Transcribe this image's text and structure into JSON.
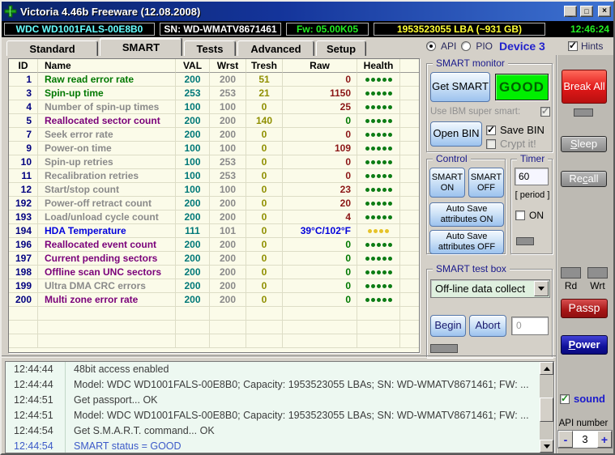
{
  "window": {
    "title": "Victoria 4.46b Freeware (12.08.2008)",
    "controls": {
      "minimize": "_",
      "maximize": "□",
      "close": "×"
    }
  },
  "infobar": {
    "model": "WDC WD1001FALS-00E8B0",
    "serial": "SN: WD-WMATV8671461",
    "firmware": "Fw: 05.00K05",
    "capacity": "1953523055 LBA (~931 GB)",
    "clock": "12:46:24"
  },
  "tabs": {
    "standard": "Standard",
    "smart": "SMART",
    "tests": "Tests",
    "advanced": "Advanced",
    "setup": "Setup"
  },
  "mode": {
    "api": "API",
    "pio": "PIO",
    "device": "Device 3",
    "hints": "Hints"
  },
  "smart_table": {
    "headers": {
      "id": "ID",
      "name": "Name",
      "val": "VAL",
      "wrst": "Wrst",
      "tresh": "Tresh",
      "raw": "Raw",
      "health": "Health"
    },
    "rows": [
      {
        "id": "1",
        "name": "Raw read error rate",
        "name_color": "green",
        "val": "200",
        "wrst": "200",
        "tresh": "51",
        "raw": "0",
        "raw_color": "red",
        "health_dots": 5,
        "health_color": "health_green"
      },
      {
        "id": "3",
        "name": "Spin-up time",
        "name_color": "green",
        "val": "253",
        "wrst": "253",
        "tresh": "21",
        "raw": "1150",
        "raw_color": "red",
        "health_dots": 5,
        "health_color": "health_green"
      },
      {
        "id": "4",
        "name": "Number of spin-up times",
        "name_color": "gray",
        "val": "100",
        "wrst": "100",
        "tresh": "0",
        "raw": "25",
        "raw_color": "red",
        "health_dots": 5,
        "health_color": "health_green"
      },
      {
        "id": "5",
        "name": "Reallocated sector count",
        "name_color": "purple",
        "val": "200",
        "wrst": "200",
        "tresh": "140",
        "raw": "0",
        "raw_color": "green",
        "health_dots": 5,
        "health_color": "health_green"
      },
      {
        "id": "7",
        "name": "Seek error rate",
        "name_color": "gray",
        "val": "200",
        "wrst": "200",
        "tresh": "0",
        "raw": "0",
        "raw_color": "red",
        "health_dots": 5,
        "health_color": "health_green"
      },
      {
        "id": "9",
        "name": "Power-on time",
        "name_color": "gray",
        "val": "100",
        "wrst": "100",
        "tresh": "0",
        "raw": "109",
        "raw_color": "red",
        "health_dots": 5,
        "health_color": "health_green"
      },
      {
        "id": "10",
        "name": "Spin-up retries",
        "name_color": "gray",
        "val": "100",
        "wrst": "253",
        "tresh": "0",
        "raw": "0",
        "raw_color": "red",
        "health_dots": 5,
        "health_color": "health_green"
      },
      {
        "id": "11",
        "name": "Recalibration retries",
        "name_color": "gray",
        "val": "100",
        "wrst": "253",
        "tresh": "0",
        "raw": "0",
        "raw_color": "red",
        "health_dots": 5,
        "health_color": "health_green"
      },
      {
        "id": "12",
        "name": "Start/stop count",
        "name_color": "gray",
        "val": "100",
        "wrst": "100",
        "tresh": "0",
        "raw": "23",
        "raw_color": "red",
        "health_dots": 5,
        "health_color": "health_green"
      },
      {
        "id": "192",
        "name": "Power-off retract count",
        "name_color": "gray",
        "val": "200",
        "wrst": "200",
        "tresh": "0",
        "raw": "20",
        "raw_color": "red",
        "health_dots": 5,
        "health_color": "health_green"
      },
      {
        "id": "193",
        "name": "Load/unload cycle count",
        "name_color": "gray",
        "val": "200",
        "wrst": "200",
        "tresh": "0",
        "raw": "4",
        "raw_color": "red",
        "health_dots": 5,
        "health_color": "health_green"
      },
      {
        "id": "194",
        "name": "HDA Temperature",
        "name_color": "blue",
        "val": "111",
        "wrst": "101",
        "tresh": "0",
        "raw": "39°C/102°F",
        "raw_color": "blue",
        "health_dots": 4,
        "health_color": "health_yellow"
      },
      {
        "id": "196",
        "name": "Reallocated event count",
        "name_color": "purple",
        "val": "200",
        "wrst": "200",
        "tresh": "0",
        "raw": "0",
        "raw_color": "green",
        "health_dots": 5,
        "health_color": "health_green"
      },
      {
        "id": "197",
        "name": "Current pending sectors",
        "name_color": "purple",
        "val": "200",
        "wrst": "200",
        "tresh": "0",
        "raw": "0",
        "raw_color": "green",
        "health_dots": 5,
        "health_color": "health_green"
      },
      {
        "id": "198",
        "name": "Offline scan UNC sectors",
        "name_color": "purple",
        "val": "200",
        "wrst": "200",
        "tresh": "0",
        "raw": "0",
        "raw_color": "green",
        "health_dots": 5,
        "health_color": "health_green"
      },
      {
        "id": "199",
        "name": "Ultra DMA CRC errors",
        "name_color": "gray",
        "val": "200",
        "wrst": "200",
        "tresh": "0",
        "raw": "0",
        "raw_color": "green",
        "health_dots": 5,
        "health_color": "health_green"
      },
      {
        "id": "200",
        "name": "Multi zone error rate",
        "name_color": "purple",
        "val": "200",
        "wrst": "200",
        "tresh": "0",
        "raw": "0",
        "raw_color": "green",
        "health_dots": 5,
        "health_color": "health_green"
      }
    ],
    "empty_rows": 3
  },
  "smart_monitor": {
    "title": "SMART monitor",
    "get_smart": "Get SMART",
    "status": "GOOD",
    "ibm_label": "Use IBM super smart:",
    "open_bin": "Open BIN",
    "save_bin": "Save BIN",
    "crypt_it": "Crypt it!"
  },
  "control": {
    "title": "Control",
    "smart_on": "SMART ON",
    "smart_off": "SMART OFF",
    "autosave_on": "Auto Save attributes ON",
    "autosave_off": "Auto Save attributes OFF"
  },
  "timer": {
    "title": "Timer",
    "period_value": "60",
    "period_label": "[ period ]",
    "on_label": "ON"
  },
  "test_box": {
    "title": "SMART test box",
    "selected_test": "Off-line data collect",
    "begin": "Begin",
    "abort": "Abort",
    "counter": "0"
  },
  "side": {
    "break_all": "Break All",
    "sleep": "Sleep",
    "recall": "Recall",
    "rd": "Rd",
    "wrt": "Wrt",
    "passp": "Passp",
    "power": "Power",
    "sound": "sound",
    "api_number_label": "API number",
    "api_number": "3",
    "minus": "-",
    "plus": "+"
  },
  "log": {
    "entries": [
      {
        "time": "12:44:44",
        "text": "48bit access enabled",
        "color": "normal"
      },
      {
        "time": "12:44:44",
        "text": "Model: WDC WD1001FALS-00E8B0; Capacity: 1953523055 LBAs; SN: WD-WMATV8671461; FW: ...",
        "color": "normal"
      },
      {
        "time": "12:44:51",
        "text": "Get passport... OK",
        "color": "normal"
      },
      {
        "time": "12:44:51",
        "text": "Model: WDC WD1001FALS-00E8B0; Capacity: 1953523055 LBAs; SN: WD-WMATV8671461; FW: ...",
        "color": "normal"
      },
      {
        "time": "12:44:54",
        "text": "Get S.M.A.R.T. command... OK",
        "color": "normal"
      },
      {
        "time": "12:44:54",
        "text": "SMART status = GOOD",
        "color": "blue"
      }
    ]
  },
  "colors": {
    "green": "#007800",
    "gray": "#8A8A8A",
    "purple": "#7A007A",
    "blue": "#0000DC",
    "red": "#8B1616",
    "teal": "#007878",
    "olive": "#8F8F00",
    "navy": "#000080",
    "health_green": "#0C7C14",
    "health_yellow": "#E6C32A",
    "status_good_bg": "#00EF00",
    "accent_button": "#9CC2EE",
    "break_red": "#E01818",
    "power_blue": "#10109A"
  }
}
